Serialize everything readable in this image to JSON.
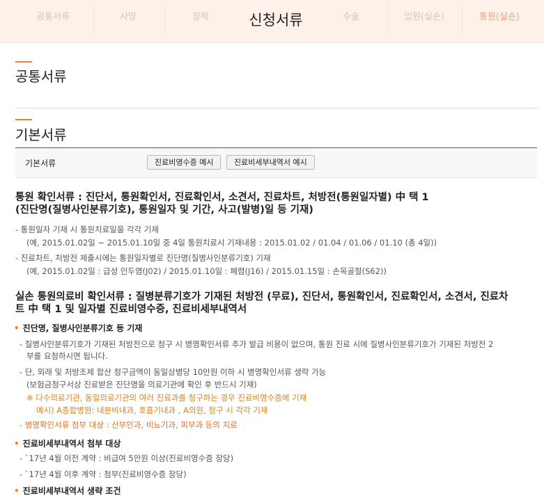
{
  "tabs": [
    {
      "label": "공통서류"
    },
    {
      "label": "사망"
    },
    {
      "label": "장해"
    },
    {
      "label": "신청서류"
    },
    {
      "label": "수술"
    },
    {
      "label": "입원(실손)"
    },
    {
      "label": "통원(실손)"
    }
  ],
  "section_common": {
    "title": "공통서류"
  },
  "section_basic": {
    "title": "기본서류",
    "row_label": "기본서류",
    "buttons": [
      "진료비영수증 예시",
      "진료비세부내역서 예시"
    ]
  },
  "visit": {
    "heading_line1": "통원 확인서류 : 진단서, 통원확인서, 진료확인서, 소견서, 진료차트, 처방전(통원일자별) 中 택 1",
    "heading_line2": "(진단명(질병사인분류기호), 통원일자 및 기간, 사고(발병)일 등 기재)",
    "notes": [
      "- 통원일자 기재 시 통원치료일을 각각 기재",
      "(예, 2015.01.02일 ~ 2015.01.10일 중 4일 통원치료시 기재내용 : 2015.01.02 / 01.04 / 01.06 / 01.10 (총 4일))",
      "- 진료차트, 처방전 제출시에는 통원일자별로 진단명(질병사인분류기호) 기재",
      "(예, 2015.01.02일 : 급성 인두염(J02) / 2015.01.10일 : 폐렴(J16) / 2015.01.15일 : 손목골절(S62))"
    ]
  },
  "loss": {
    "heading_line1": "실손 통원의료비 확인서류 : 질병분류기호가 기재된 처방전 (무료), 진단서, 통원확인서, 진료확인서, 소견서, 진료차",
    "heading_line2": "트 中 택 1 및 일자별 진료비영수증, 진료비세부내역서",
    "bullet1": "진단명, 질병사인분류기호 등 기재",
    "bullet1_lines": [
      "- 질병사인분류기호가 기재된 처방전으로 청구 시 병명확인서류 추가 발급 비용이 없으며, 통원 진료 시에 질병사인분류기호가 기재된 처방전 2",
      "부를 요청하시면 됩니다.",
      "- 단, 외래 및 처방조제 합산 청구금액이 동일상병당 10만원 이하 시 병명확인서류 생략 가능",
      "(보험금청구서상 진료받은 진단명을 의료기관에 확인 후 반드시 기재)",
      "※ 다수의료기관, 동일의료기관의 여러 진료과를 청구하는 경우 진료비영수증에 기재",
      "예시) A종합병원: 내분비내과, 호흡기내과 , A의원, 청구 시 각각 기재",
      "- 병명확인서류 첨부 대상 : 산부인과, 비뇨기과, 피부과 등의 치료"
    ],
    "bullet2": "진료비세부내역서 첨부 대상",
    "bullet2_lines": [
      "- `17년 4월 이전 계약 : 비급여 5만원 이상(진료비영수증 장당)",
      "- `17년 4월 이후 계약 : 첨부(진료비영수증 장당)"
    ],
    "bullet3": "진료비세부내역서 생략 조건"
  },
  "colors": {
    "accent": "#ef7d3c",
    "topbar_bg": "#fdf1ea",
    "note_orange": "#d9801f"
  }
}
